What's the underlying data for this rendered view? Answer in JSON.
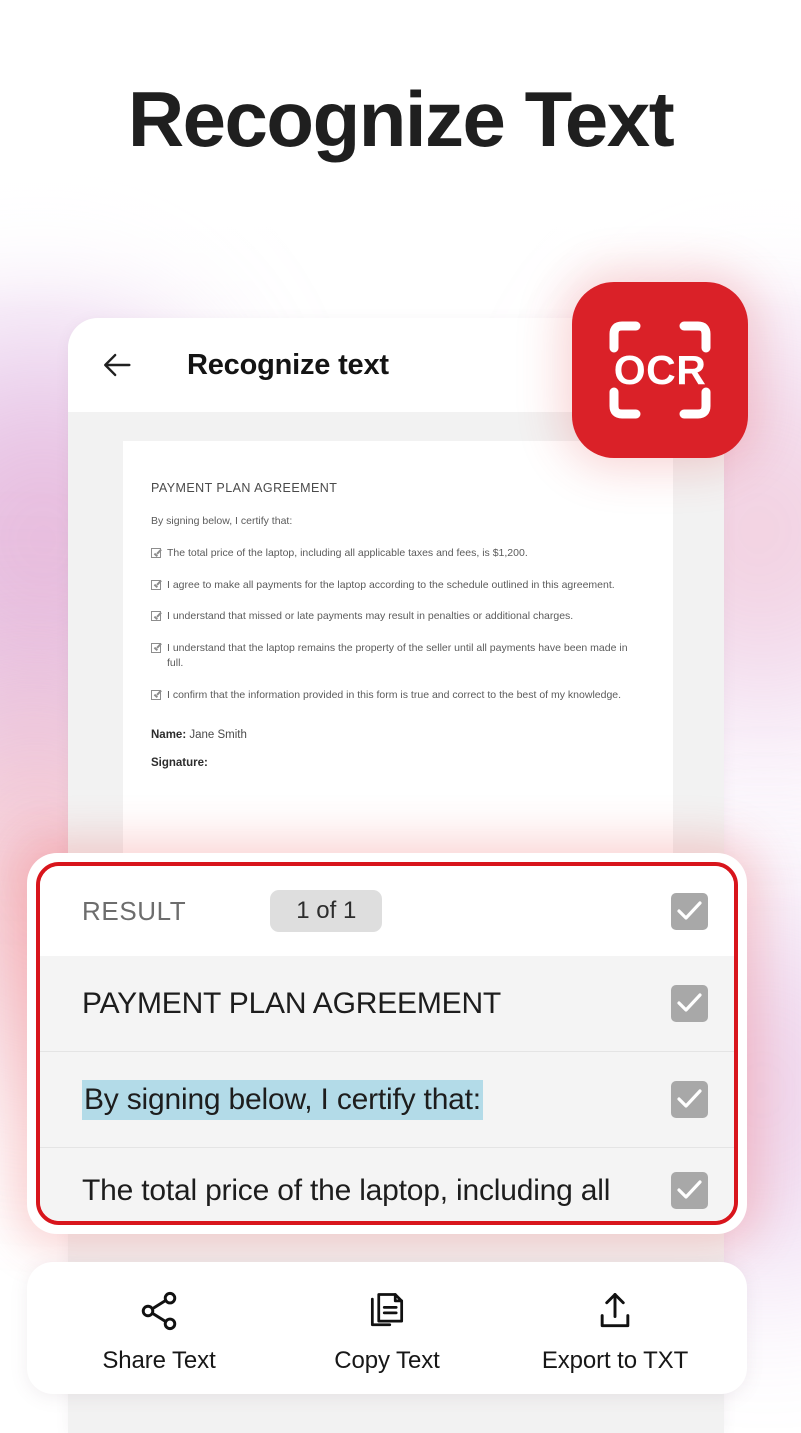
{
  "headline": "Recognize Text",
  "brand": {
    "badge_text": "OCR",
    "badge_color": "#da2128",
    "highlight_color": "#d8151c"
  },
  "phone": {
    "topbar": {
      "back_icon": "arrow-left-icon",
      "title": "Recognize text"
    },
    "document": {
      "heading": "PAYMENT PLAN AGREEMENT",
      "intro": "By signing below, I certify that:",
      "items": [
        "The total price of the laptop, including all applicable taxes and fees, is $1,200.",
        "I agree to make all payments for the laptop according to the schedule outlined in this agreement.",
        "I understand that missed or late payments may result in penalties or additional charges.",
        "I understand that the laptop remains the property of the seller until all payments have been made in full.",
        "I confirm that the information provided in this form is true and correct to the best of my knowledge."
      ],
      "name_label": "Name:",
      "name_value": "Jane Smith",
      "signature_label": "Signature:"
    }
  },
  "result_panel": {
    "label": "RESULT",
    "page_badge": "1 of 1",
    "header_checkbox": "checked",
    "rows": [
      {
        "text": "PAYMENT PLAN AGREEMENT",
        "selected": false,
        "checkbox": "checked"
      },
      {
        "text": "By signing below, I certify that:",
        "selected": true,
        "checkbox": "checked"
      },
      {
        "text": "The total price of the laptop, including all",
        "selected": false,
        "checkbox": "checked"
      }
    ],
    "selection_handle_color": "#54a5e8",
    "selection_highlight_color": "#b3dbe8"
  },
  "action_bar": {
    "actions": [
      {
        "label": "Share Text",
        "icon": "share-icon"
      },
      {
        "label": "Copy Text",
        "icon": "copy-icon"
      },
      {
        "label": "Export to TXT",
        "icon": "export-upload-icon"
      }
    ]
  }
}
